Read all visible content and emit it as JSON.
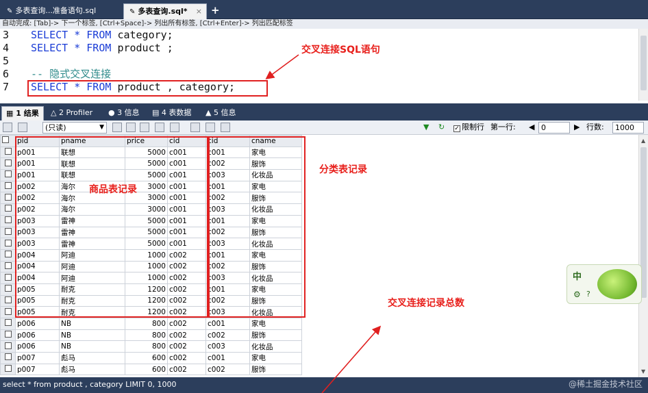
{
  "tabs": [
    {
      "label": "多表查询...准备语句.sql"
    },
    {
      "label": "多表查询.sql*"
    }
  ],
  "hint_text": "自动完成: [Tab]-> 下一个标签, [Ctrl+Space]-> 列出所有标签, [Ctrl+Enter]-> 列出匹配标签",
  "editor": {
    "lines": [
      {
        "num": "3",
        "text": "SELECT * FROM category;"
      },
      {
        "num": "4",
        "text": "SELECT * FROM product ;"
      },
      {
        "num": "5",
        "text": ""
      },
      {
        "num": "6",
        "text": "-- 隐式交叉连接"
      },
      {
        "num": "7",
        "text": "SELECT * FROM product , category;"
      }
    ]
  },
  "annotations": {
    "sql": "交叉连接SQL语句",
    "category": "分类表记录",
    "product": "商品表记录",
    "total": "交叉连接记录总数"
  },
  "result_tabs": [
    {
      "label": "1 结果"
    },
    {
      "label": "2 Profiler"
    },
    {
      "label": "3 信息"
    },
    {
      "label": "4 表数据"
    },
    {
      "label": "5 信息"
    }
  ],
  "toolbar": {
    "mode": "(只读)",
    "limit_label": "限制行",
    "first_row_label": "第一行:",
    "first_row_value": "0",
    "rows_label": "行数:",
    "rows_value": "1000"
  },
  "table": {
    "columns": [
      "pid",
      "pname",
      "price",
      "cid",
      "cid",
      "cname"
    ],
    "rows": [
      [
        "p001",
        "联想",
        "5000",
        "c001",
        "c001",
        "家电"
      ],
      [
        "p001",
        "联想",
        "5000",
        "c001",
        "c002",
        "服饰"
      ],
      [
        "p001",
        "联想",
        "5000",
        "c001",
        "c003",
        "化妆品"
      ],
      [
        "p002",
        "海尔",
        "3000",
        "c001",
        "c001",
        "家电"
      ],
      [
        "p002",
        "海尔",
        "3000",
        "c001",
        "c002",
        "服饰"
      ],
      [
        "p002",
        "海尔",
        "3000",
        "c001",
        "c003",
        "化妆品"
      ],
      [
        "p003",
        "雷神",
        "5000",
        "c001",
        "c001",
        "家电"
      ],
      [
        "p003",
        "雷神",
        "5000",
        "c001",
        "c002",
        "服饰"
      ],
      [
        "p003",
        "雷神",
        "5000",
        "c001",
        "c003",
        "化妆品"
      ],
      [
        "p004",
        "阿迪",
        "1000",
        "c002",
        "c001",
        "家电"
      ],
      [
        "p004",
        "阿迪",
        "1000",
        "c002",
        "c002",
        "服饰"
      ],
      [
        "p004",
        "阿迪",
        "1000",
        "c002",
        "c003",
        "化妆品"
      ],
      [
        "p005",
        "耐克",
        "1200",
        "c002",
        "c001",
        "家电"
      ],
      [
        "p005",
        "耐克",
        "1200",
        "c002",
        "c002",
        "服饰"
      ],
      [
        "p005",
        "耐克",
        "1200",
        "c002",
        "c003",
        "化妆品"
      ],
      [
        "p006",
        "NB",
        "800",
        "c002",
        "c001",
        "家电"
      ],
      [
        "p006",
        "NB",
        "800",
        "c002",
        "c002",
        "服饰"
      ],
      [
        "p006",
        "NB",
        "800",
        "c002",
        "c003",
        "化妆品"
      ],
      [
        "p007",
        "彪马",
        "600",
        "c002",
        "c001",
        "家电"
      ],
      [
        "p007",
        "彪马",
        "600",
        "c002",
        "c002",
        "服饰"
      ]
    ]
  },
  "widget": {
    "label": "中"
  },
  "status": "select * from product , category LIMIT 0, 1000",
  "watermark": "@稀土掘金技术社区",
  "colors": {
    "annotation": "#e02020",
    "keyword": "#1a3cd6",
    "comment": "#2d8a8a",
    "chrome": "#2c3e5c"
  }
}
